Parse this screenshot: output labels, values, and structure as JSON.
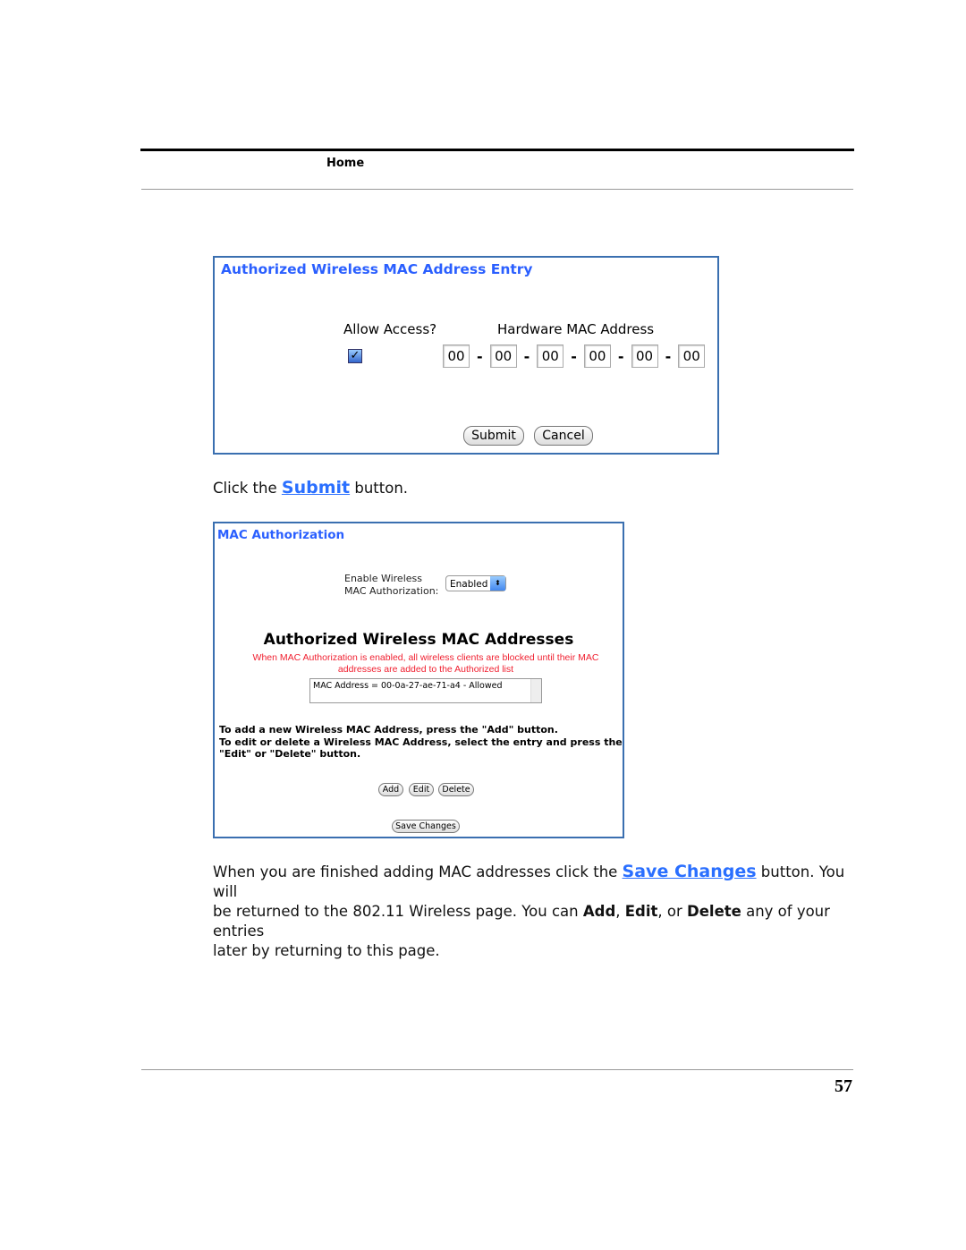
{
  "header": {
    "label": "Home"
  },
  "entry_panel": {
    "title": "Authorized Wireless MAC Address Entry",
    "allow_label": "Allow Access?",
    "mac_label": "Hardware MAC Address",
    "allow_checked": true,
    "octets": [
      "00",
      "00",
      "00",
      "00",
      "00",
      "00"
    ],
    "separator": "-",
    "submit": "Submit",
    "cancel": "Cancel"
  },
  "step1": {
    "prefix": "Click the ",
    "link": "Submit",
    "suffix": " button."
  },
  "auth_panel": {
    "title": "MAC Authorization",
    "enable_label_1": "Enable Wireless",
    "enable_label_2": "MAC Authorization:",
    "select_value": "Enabled",
    "heading": "Authorized Wireless MAC Addresses",
    "warning_1": "When MAC Authorization is enabled, all wireless clients are blocked until their MAC",
    "warning_2": "addresses are added to the Authorized list",
    "list_items": [
      "MAC Address = 00-0a-27-ae-71-a4 - Allowed"
    ],
    "instr_1": "To add a new Wireless MAC Address, press the \"Add\" button.",
    "instr_2": "To edit or delete a Wireless MAC Address, select the entry and press the",
    "instr_3": "\"Edit\" or \"Delete\" button.",
    "add": "Add",
    "edit": "Edit",
    "delete": "Delete",
    "save": "Save Changes"
  },
  "step2": {
    "t1": "When you are finished adding MAC addresses click the ",
    "link": "Save Changes",
    "t2": " button. You will",
    "t3": "be returned to the 802.11 Wireless page. You can ",
    "add": "Add",
    "c1": ", ",
    "edit": "Edit",
    "c2": ", or ",
    "delete": "Delete",
    "t4": " any of your entries",
    "t5": "later by returning to this page."
  },
  "footer": {
    "page_number": "57"
  }
}
